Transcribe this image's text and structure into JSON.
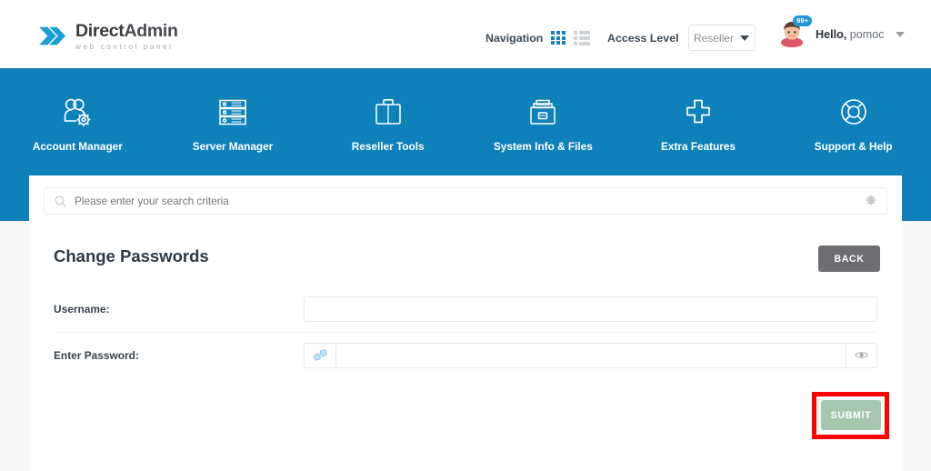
{
  "brand": {
    "title_strong": "Direct",
    "title_light": "Admin",
    "tagline": "web control panel",
    "logo_icon": "double-chevron-icon",
    "accent_blue": "#0e81bb",
    "logo_blue": "#1b9dd9"
  },
  "header": {
    "navigation_label": "Navigation",
    "grid_view_icon": "grid-view-icon",
    "list_view_icon": "list-view-icon",
    "access_level_label": "Access Level",
    "access_level_value": "Reseller",
    "dropdown_icon": "chevron-down-icon",
    "avatar_icon": "user-avatar",
    "notification_badge": "99+",
    "greeting_prefix": "Hello,",
    "username": "pomoc",
    "user_menu_icon": "chevron-down-icon"
  },
  "nav": {
    "items": [
      {
        "label": "Account Manager",
        "icon": "users-gear-icon"
      },
      {
        "label": "Server Manager",
        "icon": "server-rack-icon"
      },
      {
        "label": "Reseller Tools",
        "icon": "briefcase-icon"
      },
      {
        "label": "System Info & Files",
        "icon": "file-cabinet-icon"
      },
      {
        "label": "Extra Features",
        "icon": "plus-icon"
      },
      {
        "label": "Support & Help",
        "icon": "lifebuoy-icon"
      }
    ]
  },
  "search": {
    "placeholder": "Please enter your search criteria",
    "value": "",
    "search_icon": "search-icon",
    "settings_icon": "gear-icon"
  },
  "main": {
    "page_title": "Change Passwords",
    "back_label": "BACK",
    "fields": [
      {
        "label": "Username:",
        "value": "",
        "placeholder": ""
      },
      {
        "label": "Enter Password:",
        "value": "",
        "placeholder": ""
      }
    ],
    "password_generate_icon": "dice-random-icon",
    "password_reveal_icon": "eye-icon",
    "submit_label": "SUBMIT",
    "submit_color": "#a6c6ae",
    "highlight_color": "#ff0000",
    "back_color": "#6d6e71"
  }
}
